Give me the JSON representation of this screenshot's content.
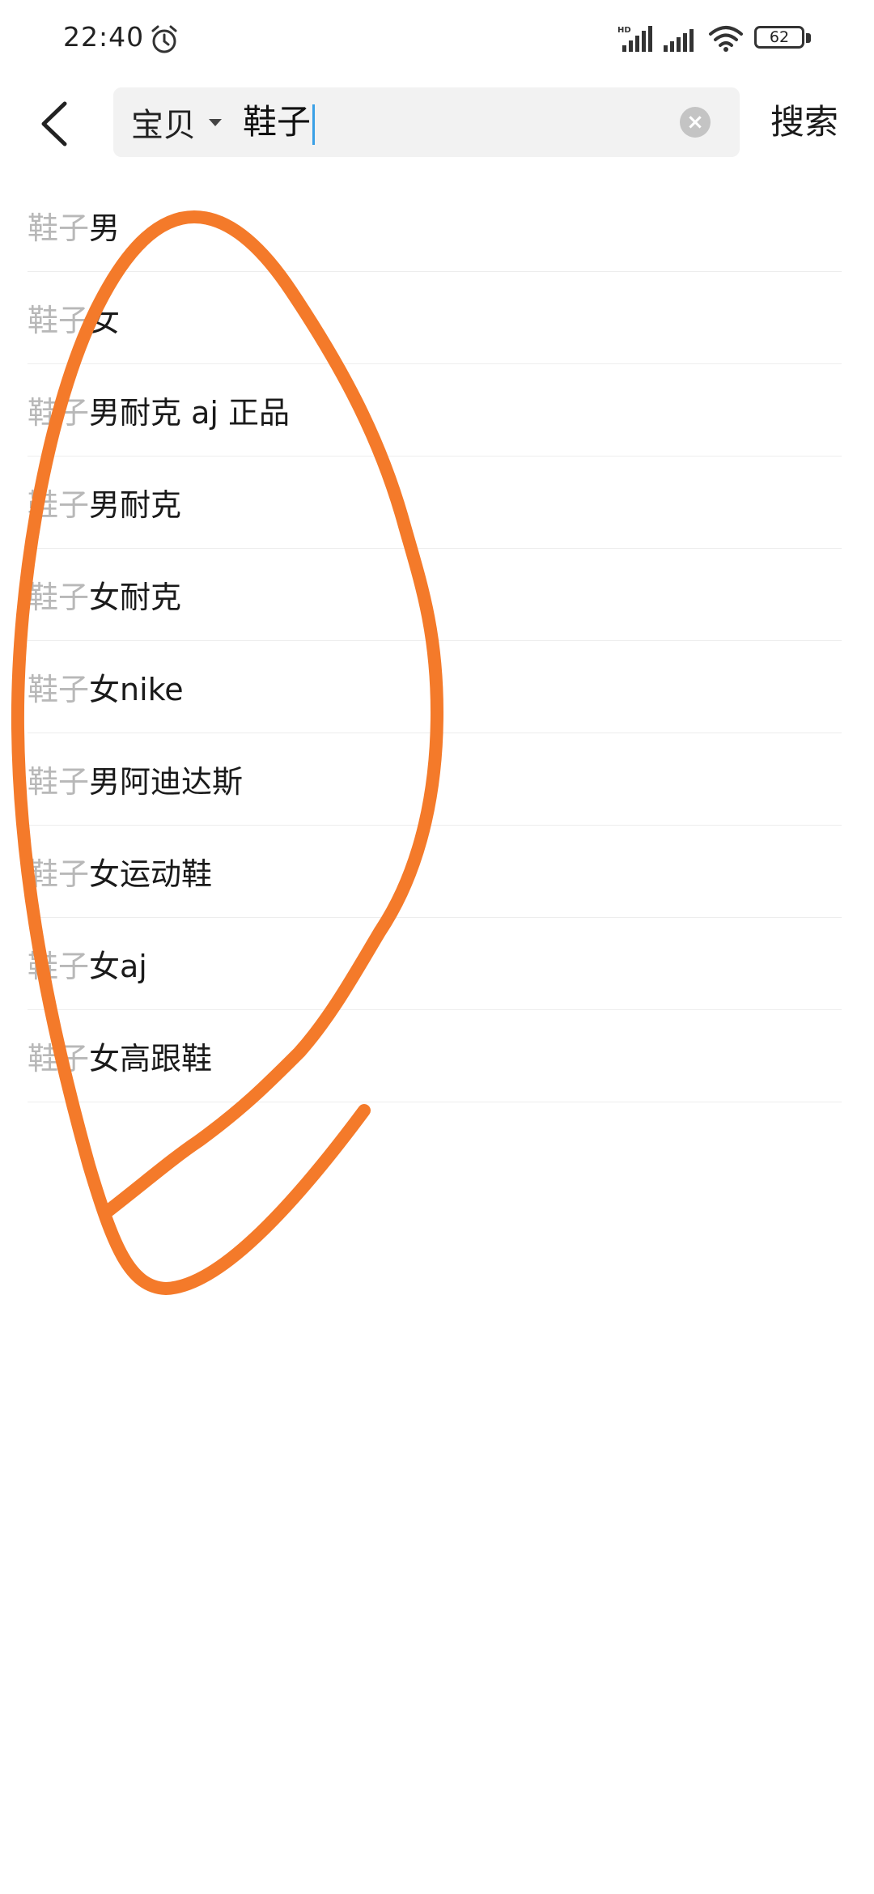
{
  "status_bar": {
    "time": "22:40",
    "battery": "62",
    "icons": [
      "alarm-icon",
      "signal-hd-icon",
      "signal-icon",
      "wifi-icon",
      "battery-icon"
    ]
  },
  "header": {
    "back_icon": "back-arrow-icon",
    "scope": "宝贝",
    "query": "鞋子",
    "clear_icon": "clear-icon",
    "search_label": "搜索"
  },
  "suggestions": [
    {
      "prefix": "鞋子",
      "rest": "男"
    },
    {
      "prefix": "鞋子",
      "rest": "女"
    },
    {
      "prefix": "鞋子",
      "rest": "男耐克 aj 正品"
    },
    {
      "prefix": "鞋子",
      "rest": "男耐克"
    },
    {
      "prefix": "鞋子",
      "rest": "女耐克"
    },
    {
      "prefix": "鞋子",
      "rest": "女nike"
    },
    {
      "prefix": "鞋子",
      "rest": "男阿迪达斯"
    },
    {
      "prefix": "鞋子",
      "rest": "女运动鞋"
    },
    {
      "prefix": "鞋子",
      "rest": "女aj"
    },
    {
      "prefix": "鞋子",
      "rest": "女高跟鞋"
    }
  ],
  "colors": {
    "annotation_stroke": "#f47a2a",
    "cursor": "#3aa0e6",
    "prefix_text": "#b8b8b8"
  }
}
